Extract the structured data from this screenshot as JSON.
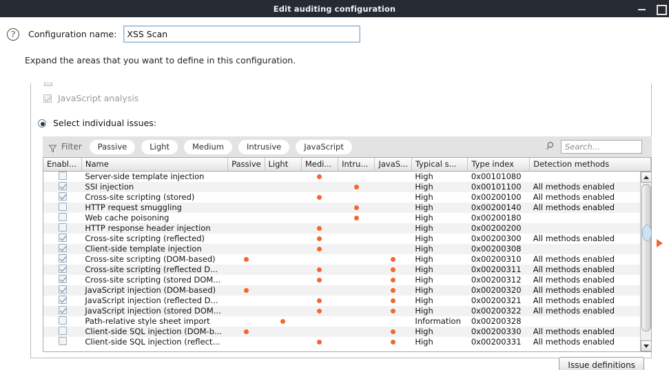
{
  "window": {
    "title": "Edit auditing configuration",
    "minimize_label": "Minimize",
    "maximize_label": "Maximize"
  },
  "form": {
    "help_glyph": "?",
    "config_label": "Configuration name:",
    "config_value": "XSS Scan",
    "hint": "Expand the areas that you want to define in this configuration."
  },
  "options": {
    "javascript_analysis_label": "JavaScript analysis",
    "select_individual_label": "Select individual issues:"
  },
  "filterbar": {
    "label": "Filter",
    "chips": [
      "Passive",
      "Light",
      "Medium",
      "Intrusive",
      "JavaScript"
    ],
    "search_placeholder": "Search...",
    "search_value": ""
  },
  "table": {
    "columns": [
      "Enabl...",
      "Name",
      "Passive",
      "Light",
      "Medi...",
      "Intru...",
      "JavaS...",
      "Typical s...",
      "Type index",
      "Detection methods"
    ],
    "rows": [
      {
        "enabled": false,
        "name": "Server-side template injection",
        "passive": false,
        "light": false,
        "medium": true,
        "intrusive": false,
        "javascript": false,
        "severity": "High",
        "type_index": "0x00101080",
        "detection": ""
      },
      {
        "enabled": true,
        "name": "SSI injection",
        "passive": false,
        "light": false,
        "medium": false,
        "intrusive": true,
        "javascript": false,
        "severity": "High",
        "type_index": "0x00101100",
        "detection": "All methods enabled"
      },
      {
        "enabled": true,
        "name": "Cross-site scripting (stored)",
        "passive": false,
        "light": false,
        "medium": true,
        "intrusive": false,
        "javascript": false,
        "severity": "High",
        "type_index": "0x00200100",
        "detection": "All methods enabled"
      },
      {
        "enabled": false,
        "name": "HTTP request smuggling",
        "passive": false,
        "light": false,
        "medium": false,
        "intrusive": true,
        "javascript": false,
        "severity": "High",
        "type_index": "0x00200140",
        "detection": "All methods enabled"
      },
      {
        "enabled": false,
        "name": "Web cache poisoning",
        "passive": false,
        "light": false,
        "medium": false,
        "intrusive": true,
        "javascript": false,
        "severity": "High",
        "type_index": "0x00200180",
        "detection": ""
      },
      {
        "enabled": false,
        "name": "HTTP response header injection",
        "passive": false,
        "light": false,
        "medium": true,
        "intrusive": false,
        "javascript": false,
        "severity": "High",
        "type_index": "0x00200200",
        "detection": ""
      },
      {
        "enabled": true,
        "name": "Cross-site scripting (reflected)",
        "passive": false,
        "light": false,
        "medium": true,
        "intrusive": false,
        "javascript": false,
        "severity": "High",
        "type_index": "0x00200300",
        "detection": "All methods enabled"
      },
      {
        "enabled": true,
        "name": "Client-side template injection",
        "passive": false,
        "light": false,
        "medium": true,
        "intrusive": false,
        "javascript": false,
        "severity": "High",
        "type_index": "0x00200308",
        "detection": ""
      },
      {
        "enabled": true,
        "name": "Cross-site scripting (DOM-based)",
        "passive": true,
        "light": false,
        "medium": false,
        "intrusive": false,
        "javascript": true,
        "severity": "High",
        "type_index": "0x00200310",
        "detection": "All methods enabled"
      },
      {
        "enabled": true,
        "name": "Cross-site scripting (reflected D...",
        "passive": false,
        "light": false,
        "medium": true,
        "intrusive": false,
        "javascript": true,
        "severity": "High",
        "type_index": "0x00200311",
        "detection": "All methods enabled"
      },
      {
        "enabled": true,
        "name": "Cross-site scripting (stored DOM...",
        "passive": false,
        "light": false,
        "medium": true,
        "intrusive": false,
        "javascript": true,
        "severity": "High",
        "type_index": "0x00200312",
        "detection": "All methods enabled"
      },
      {
        "enabled": true,
        "name": "JavaScript injection (DOM-based)",
        "passive": true,
        "light": false,
        "medium": false,
        "intrusive": false,
        "javascript": true,
        "severity": "High",
        "type_index": "0x00200320",
        "detection": "All methods enabled"
      },
      {
        "enabled": true,
        "name": "JavaScript injection (reflected D...",
        "passive": false,
        "light": false,
        "medium": true,
        "intrusive": false,
        "javascript": true,
        "severity": "High",
        "type_index": "0x00200321",
        "detection": "All methods enabled"
      },
      {
        "enabled": true,
        "name": "JavaScript injection (stored DOM...",
        "passive": false,
        "light": false,
        "medium": true,
        "intrusive": false,
        "javascript": true,
        "severity": "High",
        "type_index": "0x00200322",
        "detection": "All methods enabled"
      },
      {
        "enabled": false,
        "name": "Path-relative style sheet import",
        "passive": false,
        "light": true,
        "medium": false,
        "intrusive": false,
        "javascript": false,
        "severity": "Information",
        "type_index": "0x00200328",
        "detection": ""
      },
      {
        "enabled": false,
        "name": "Client-side SQL injection (DOM-b...",
        "passive": true,
        "light": false,
        "medium": false,
        "intrusive": false,
        "javascript": true,
        "severity": "High",
        "type_index": "0x00200330",
        "detection": "All methods enabled"
      },
      {
        "enabled": false,
        "name": "Client-side SQL injection (reflect...",
        "passive": false,
        "light": false,
        "medium": true,
        "intrusive": false,
        "javascript": true,
        "severity": "High",
        "type_index": "0x00200331",
        "detection": "All methods enabled"
      }
    ]
  },
  "footer": {
    "issue_definitions_label": "Issue definitions"
  },
  "colors": {
    "accent_dot": "#f3672d",
    "titlebar_bg": "#262a33",
    "filterbar_bg": "#e3e3e3"
  }
}
